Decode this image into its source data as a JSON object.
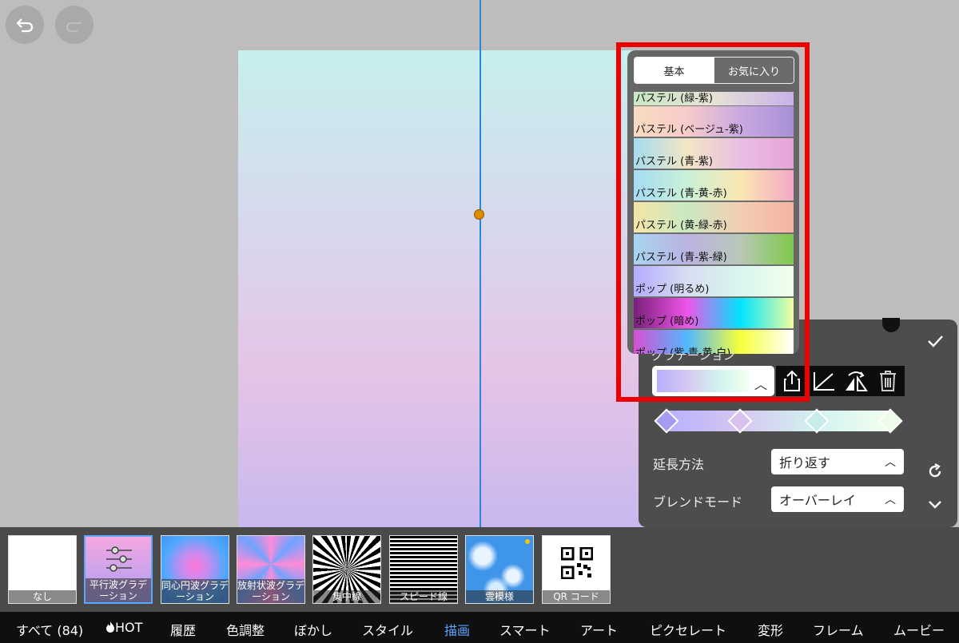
{
  "icons": {
    "undo": "undo-arrow-icon",
    "redo": "redo-icon",
    "share": "share-icon",
    "slope": "slope-angle-icon",
    "flip": "flip-icon",
    "trash": "trash-icon",
    "check": "checkmark-icon",
    "reset": "reset-icon",
    "collapse": "chevron-down-icon",
    "fire": "fire-icon"
  },
  "preset_panel": {
    "tabs": [
      "基本",
      "お気に入り"
    ],
    "items": [
      {
        "label": "パステル (緑-紫)",
        "gradient": "linear-gradient(to right,#c8e8c4,#e6e2d6,#c9b1ea)"
      },
      {
        "label": "パステル (ベージュ-紫)",
        "gradient": "linear-gradient(to right,#f8dcc1,#f8cbc9,#c9a9e2,#a890d6)"
      },
      {
        "label": "パステル (青-紫)",
        "gradient": "linear-gradient(to right,#a6dcef,#f2e6c5,#e9bee3,#e5a4d8)"
      },
      {
        "label": "パステル (青-黄-赤)",
        "gradient": "linear-gradient(to right,#a5dbf5,#c9f1d6,#fbe7b2,#f4a8c5)"
      },
      {
        "label": "パステル (黄-緑-赤)",
        "gradient": "linear-gradient(to right,#f5e5a8,#c9e9c1,#f3ceb2,#f5b4a3)"
      },
      {
        "label": "パステル (青-紫-緑)",
        "gradient": "linear-gradient(to right,#a6d5f2,#bcb3e2,#b8c8b8,#80c84a)"
      },
      {
        "label": "ポップ (明るめ)",
        "gradient": "linear-gradient(to right,#b4acff,#d8ddf2,#d9f6ee,#f2ffee)"
      },
      {
        "label": "ポップ (暗め)",
        "gradient": "linear-gradient(to right,#7a1f7a,#ee55e8,#00e4ff,#f1ff9e)"
      },
      {
        "label": "ポップ (紫-青-黄-白)",
        "gradient": "linear-gradient(to right,#d84fd2,#53b8ff,#f6ff3b,#ffffff)"
      }
    ]
  },
  "gradient_panel": {
    "label": "グラデーション",
    "selected_gradient": "linear-gradient(to right,#b7b0ff,#d6c7f0,#d2f2f0,#f2ffef)",
    "stops": [
      {
        "position": 0,
        "color": "#a39cf2"
      },
      {
        "position": 0.33,
        "color": "#d9c1ee"
      },
      {
        "position": 0.67,
        "color": "#c8ecec"
      },
      {
        "position": 1,
        "color": "#effbe9"
      }
    ],
    "extension_label": "延長方法",
    "extension_value": "折り返す",
    "blend_label": "ブレンドモード",
    "blend_value": "オーバーレイ"
  },
  "thumbnails": [
    {
      "caption": "なし",
      "style": "background:#ffffff"
    },
    {
      "caption": "平行波グラデーション",
      "style": "background:linear-gradient(#f5a7e0,#a89ff3)",
      "selected": true
    },
    {
      "caption": "同心円波グラデーション",
      "style": "background:radial-gradient(circle at 50% 45%,#ff78d9 0%,#c68cf0 28%,#4fa8ff 62%,#3b8ff6 100%)"
    },
    {
      "caption": "放射状波グラデーション",
      "style": "background:conic-gradient(from 0deg at 50% 42%,#ff8bd8,#6fa3ff,#ff8bd8,#6fa3ff,#ff8bd8,#6fa3ff,#ff8bd8,#6fa3ff,#ff8bd8)"
    },
    {
      "caption": "集中線",
      "style": "background:repeating-conic-gradient(from 0deg at 50% 50%,#000 0deg 7deg,#fff 7deg 14deg)"
    },
    {
      "caption": "スピード線",
      "style": "background:repeating-linear-gradient(to bottom,#000 0 3px,#fff 3px 5px)"
    },
    {
      "caption": "雲模様",
      "style": "background:radial-gradient(circle at 25% 30%,#e8f4ff 0 12%,transparent 22%),radial-gradient(circle at 70% 60%,#e8f4ff 0 10%,transparent 20%),radial-gradient(circle at 45% 80%,#d6ecff 0 10%,transparent 20%),#3f95ea"
    },
    {
      "caption": "QR コード",
      "style": "background:#ffffff"
    }
  ],
  "menu": [
    "すべて (84)",
    "HOT",
    "履歴",
    "色調整",
    "ぼかし",
    "スタイル",
    "描画",
    "スマート",
    "アート",
    "ピクセレート",
    "変形",
    "フレーム",
    "ムービー"
  ],
  "active_menu": "描画",
  "colors": {
    "accent": "#5aa7ff",
    "highlight_box": "#ee0000",
    "vertical_guide": "#2b87d8",
    "handle": "#e08a00"
  }
}
